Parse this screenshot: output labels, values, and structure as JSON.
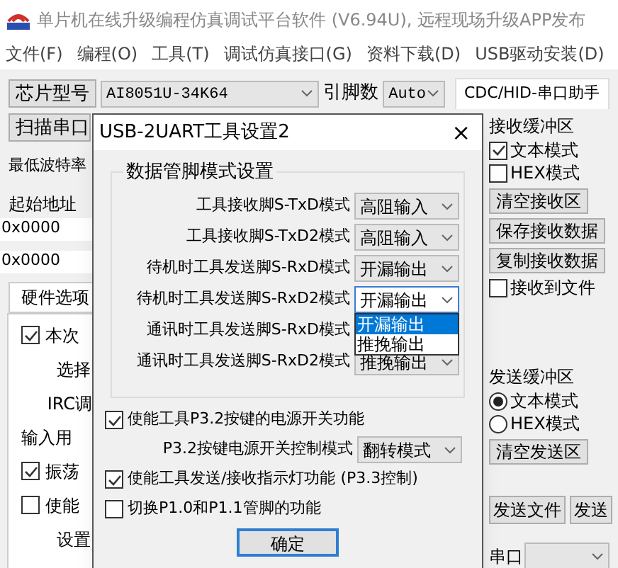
{
  "window": {
    "title": "单片机在线升级编程仿真调试平台软件 (V6.94U), 远程现场升级APP发布"
  },
  "menu": [
    "文件(F)",
    "编程(O)",
    "工具(T)",
    "调试仿真接口(G)",
    "资料下载(D)",
    "USB驱动安装(D)"
  ],
  "toolbar": {
    "chip_button": "芯片型号",
    "chip": "AI8051U-34K64",
    "pins_label": "引脚数",
    "pins": "Auto",
    "tab": "CDC/HID-串口助手",
    "scan_button": "扫描串口"
  },
  "left_panel": {
    "baud_label": "最低波特率",
    "start_label": "起始地址",
    "fields": [
      "0x0000",
      "0x0000"
    ],
    "tab": "硬件选项",
    "items": [
      {
        "kind": "checkbox",
        "label": "本次",
        "checked": true
      },
      {
        "kind": "text",
        "label": "选择"
      },
      {
        "kind": "text",
        "label": "IRC调"
      },
      {
        "kind": "plain",
        "label": "输入用"
      },
      {
        "kind": "checkbox",
        "label": "振荡",
        "checked": true
      },
      {
        "kind": "checkbox",
        "label": "使能",
        "checked": false
      },
      {
        "kind": "text",
        "label": "设置"
      }
    ]
  },
  "receive": {
    "title": "接收缓冲区",
    "modes": [
      {
        "label": "文本模式",
        "checked": true
      },
      {
        "label": "HEX模式",
        "checked": false
      }
    ],
    "buttons": [
      "清空接收区",
      "保存接收数据",
      "复制接收数据"
    ],
    "to_file": {
      "label": "接收到文件",
      "checked": false
    }
  },
  "send": {
    "title": "发送缓冲区",
    "modes": [
      {
        "label": "文本模式",
        "selected": true
      },
      {
        "label": "HEX模式",
        "selected": false
      }
    ],
    "clear_button": "清空发送区",
    "buttons": [
      "发送文件",
      "发送"
    ],
    "port_label": "串口"
  },
  "dialog": {
    "title": "USB-2UART工具设置2",
    "close": "×",
    "group": "数据管脚模式设置",
    "rows": [
      {
        "label": "工具接收脚S-TxD模式",
        "value": "高阻输入",
        "open": false
      },
      {
        "label": "工具接收脚S-TxD2模式",
        "value": "高阻输入",
        "open": false
      },
      {
        "label": "待机时工具发送脚S-RxD模式",
        "value": "开漏输出",
        "open": false
      },
      {
        "label": "待机时工具发送脚S-RxD2模式",
        "value": "开漏输出",
        "open": true,
        "options": [
          {
            "label": "开漏输出",
            "selected": true
          },
          {
            "label": "推挽输出",
            "selected": false
          }
        ]
      },
      {
        "label": "通讯时工具发送脚S-RxD模式",
        "open": false
      },
      {
        "label": "通讯时工具发送脚S-RxD2模式",
        "value": "推挽输出",
        "open": false
      }
    ],
    "options": [
      {
        "kind": "checkbox",
        "label": "使能工具P3.2按键的电源开关功能",
        "checked": true
      },
      {
        "kind": "select",
        "label": "P3.2按键电源开关控制模式",
        "value": "翻转模式"
      },
      {
        "kind": "checkbox",
        "label": "使能工具发送/接收指示灯功能 (P3.3控制)",
        "checked": true
      },
      {
        "kind": "checkbox",
        "label": "切换P1.0和P1.1管脚的功能",
        "checked": false
      }
    ],
    "ok_button": "确定"
  }
}
